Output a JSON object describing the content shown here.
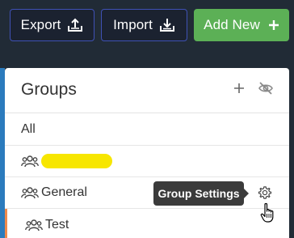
{
  "toolbar": {
    "export_label": "Export",
    "import_label": "Import",
    "add_new_label": "Add New"
  },
  "groups_panel": {
    "title": "Groups",
    "items": [
      {
        "label": "All"
      },
      {
        "label": ""
      },
      {
        "label": "General"
      },
      {
        "label": "Test"
      }
    ],
    "tooltip": "Group Settings"
  },
  "icons": {
    "export": "export-upload-icon",
    "import": "import-download-icon",
    "add": "plus-icon",
    "hide": "eye-slash-icon",
    "group": "users-group-icon",
    "settings": "gear-icon",
    "cursor": "hand-pointer-cursor"
  },
  "colors": {
    "toolbar_bg": "#212b36",
    "button_border": "#3f51b5",
    "add_button": "#5cb056",
    "selected_accent": "#ef8a4c",
    "redaction": "#f7e600",
    "tooltip_bg": "#3b3b3b"
  }
}
